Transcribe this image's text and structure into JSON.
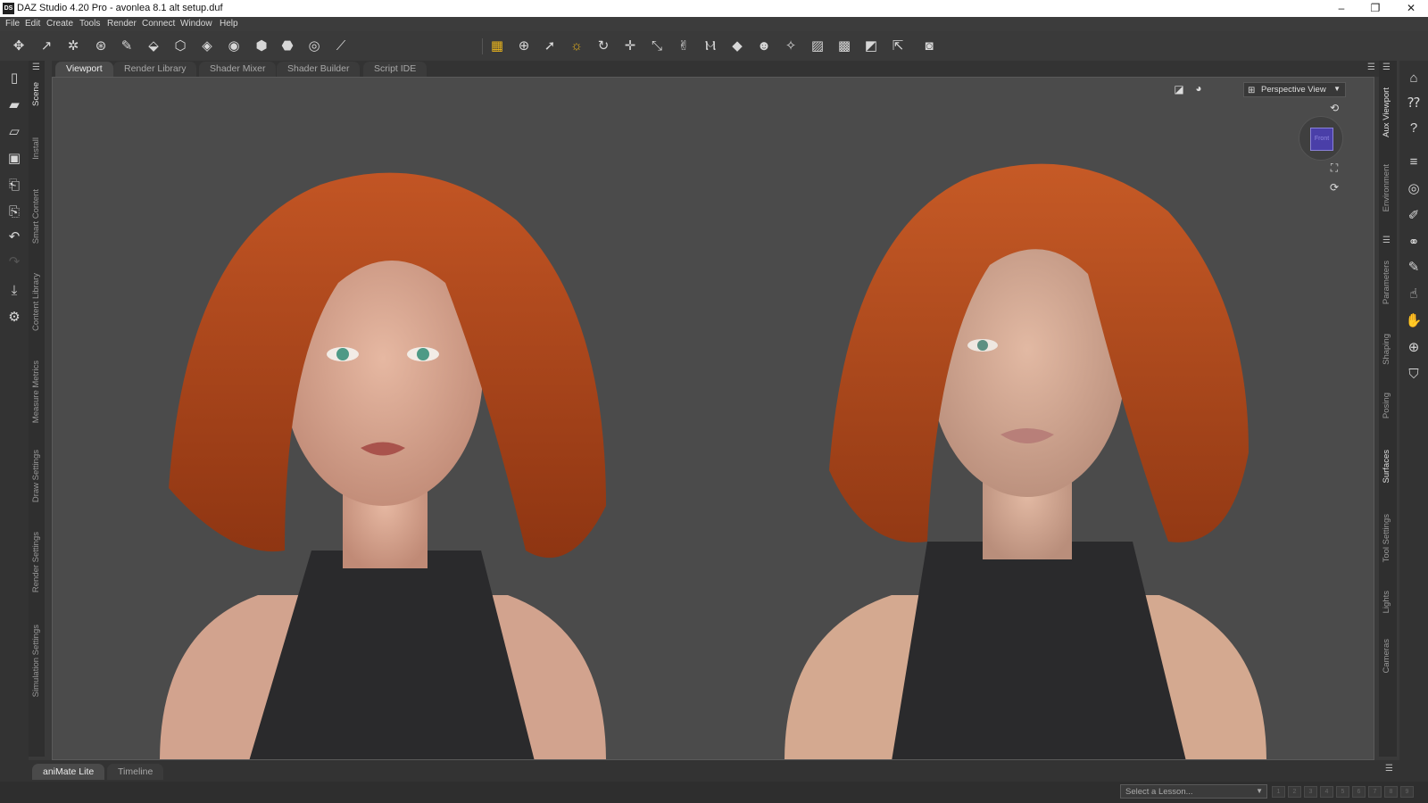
{
  "window": {
    "app_icon": "DS",
    "title": "DAZ Studio 4.20 Pro - avonlea 8.1 alt setup.duf",
    "minimize": "–",
    "maximize": "❐",
    "close": "✕"
  },
  "menu": [
    "File",
    "Edit",
    "Create",
    "Tools",
    "Render",
    "Connect",
    "Window",
    "Help"
  ],
  "viewport_tabs": [
    "Viewport",
    "Render Library",
    "Shader Mixer",
    "Shader Builder",
    "Script IDE"
  ],
  "left_panes": [
    "Scene",
    "Install",
    "Smart Content",
    "Content Library",
    "Measure Metrics",
    "Draw Settings",
    "Render Settings",
    "Simulation Settings"
  ],
  "right_panes": [
    "Aux Viewport",
    "Environment",
    "Parameters",
    "Shaping",
    "Posing",
    "Surfaces",
    "Tool Settings",
    "Lights",
    "Cameras"
  ],
  "viewport": {
    "camera": "Perspective View",
    "cube_face": "Front"
  },
  "bottom_tabs": [
    "aniMate Lite",
    "Timeline"
  ],
  "status": {
    "lesson_placeholder": "Select a Lesson...",
    "steps": [
      "1",
      "2",
      "3",
      "4",
      "5",
      "6",
      "7",
      "8",
      "9"
    ]
  },
  "icons": {
    "toolbar_left": [
      "figure-setup-icon",
      "joint-editor-icon",
      "rigid-follow-icon",
      "node-weight-icon",
      "joint-tool-icon",
      "geometry-editor-icon",
      "polygon-group-icon",
      "geometry-sculpt-icon",
      "transfer-icon",
      "weight-map-icon",
      "surface-selection-icon",
      "node-selection-icon",
      "bone-tool-icon"
    ],
    "toolbar_center": [
      "node-grid-icon",
      "universal-tool-icon",
      "pointer-icon",
      "active-pose-icon",
      "rotate-tool-icon",
      "translate-tool-icon",
      "scale-tool-icon",
      "joint-rotate-icon",
      "edge-tool-icon",
      "surface-tool-icon",
      "posing-tool-icon",
      "spot-render-icon",
      "region-render-icon",
      "image-edit-icon",
      "camera-grab-icon",
      "select-tool-icon",
      "camera-icon"
    ]
  },
  "colors": {
    "accent": "#e7b21c",
    "cube_face": "#4a3fa8",
    "viewport_bg": "#4b4b4b",
    "hair": "#b84a1c"
  }
}
